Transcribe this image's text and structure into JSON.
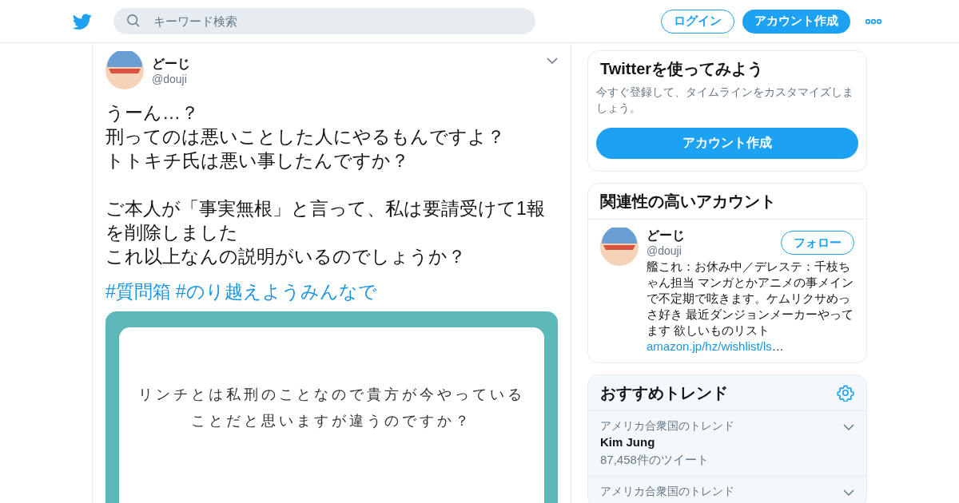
{
  "header": {
    "search": {
      "placeholder": "キーワード検索"
    },
    "login_button": "ログイン",
    "signup_button": "アカウント作成"
  },
  "tweet": {
    "name": "どーじ",
    "handle": "@douji",
    "paragraphs": [
      [
        "うーん…？",
        "刑ってのは悪いことした人にやるもんですよ？",
        "トトキチ氏は悪い事したんですか？"
      ],
      [
        "ご本人が「事実無根」と言って、私は要請受けて1報を削除しました",
        "これ以上なんの説明がいるのでしょうか？"
      ]
    ],
    "hashtags": [
      "#質問箱",
      "#のり越えようみんなで"
    ],
    "card_text": "リンチとは私刑のことなので貴方が今やっていることだと思いますが違うのですか？"
  },
  "signup_card": {
    "title": "Twitterを使ってみよう",
    "text": "今すぐ登録して、タイムラインをカスタマイズしましょう。",
    "button": "アカウント作成"
  },
  "related": {
    "title": "関連性の高いアカウント",
    "accounts": [
      {
        "name": "どーじ",
        "handle": "@douji",
        "follow_button": "フォロー",
        "bio": "艦これ：お休み中／デレステ：千枝ちゃん担当 マンガとかアニメの事メインで不定期で呟きます。ケムリクサめっさ好き 最近ダンジョンメーカーやってます 欲しいものリスト",
        "link": "amazon.jp/hz/wishlist/ls",
        "link_ellipsis": "…"
      }
    ]
  },
  "trends": {
    "title": "おすすめトレンド",
    "items": [
      {
        "context": "アメリカ合衆国のトレンド",
        "name": "Kim Jung",
        "count": "87,458件のツイート"
      },
      {
        "context": "アメリカ合衆国のトレンド"
      }
    ]
  }
}
